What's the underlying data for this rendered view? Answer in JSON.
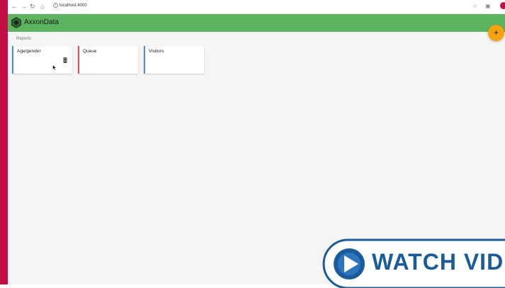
{
  "browser": {
    "url": "localhost:4000",
    "icons": [
      "back-icon",
      "forward-icon",
      "reload-icon",
      "home-icon",
      "star-icon",
      "extension-icon",
      "profile-icon"
    ]
  },
  "app": {
    "title": "AxxonData"
  },
  "reports": {
    "label": "Reports",
    "cards": [
      {
        "title": "Age/gender",
        "accent": "#4a90d9"
      },
      {
        "title": "Queue",
        "accent": "#d9534f"
      },
      {
        "title": "Visitors",
        "accent": "#4a90d9"
      }
    ]
  },
  "fab": {
    "label": "+",
    "color": "#f7a30d"
  },
  "overlay": {
    "label": "WATCH VID",
    "color": "#1c5b9a"
  },
  "colors": {
    "appbar": "#5cb461",
    "stripe": "#c20d45",
    "background": "#f5f5f5"
  }
}
